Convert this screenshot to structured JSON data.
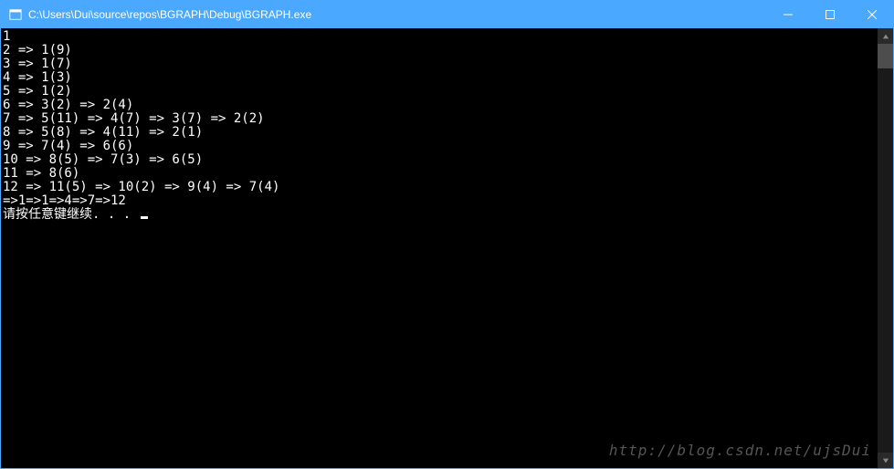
{
  "window": {
    "title": "C:\\Users\\Dui\\source\\repos\\BGRAPH\\Debug\\BGRAPH.exe"
  },
  "console": {
    "lines": [
      "",
      "1",
      "2 => 1(9)",
      "3 => 1(7)",
      "4 => 1(3)",
      "5 => 1(2)",
      "6 => 3(2) => 2(4)",
      "7 => 5(11) => 4(7) => 3(7) => 2(2)",
      "8 => 5(8) => 4(11) => 2(1)",
      "9 => 7(4) => 6(6)",
      "10 => 8(5) => 7(3) => 6(5)",
      "11 => 8(6)",
      "12 => 11(5) => 10(2) => 9(4) => 7(4)",
      "",
      "=>1=>1=>4=>7=>12"
    ],
    "prompt": "请按任意键继续. . . "
  },
  "watermark": "http://blog.csdn.net/ujsDui"
}
